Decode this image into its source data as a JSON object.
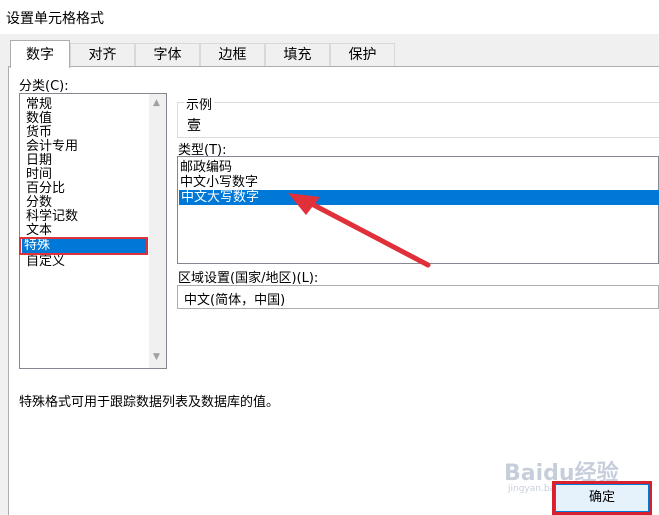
{
  "window": {
    "title": "设置单元格格式"
  },
  "tabs": [
    {
      "label": "数字",
      "active": true
    },
    {
      "label": "对齐",
      "active": false
    },
    {
      "label": "字体",
      "active": false
    },
    {
      "label": "边框",
      "active": false
    },
    {
      "label": "填充",
      "active": false
    },
    {
      "label": "保护",
      "active": false
    }
  ],
  "category": {
    "label": "分类(C):",
    "items": [
      "常规",
      "数值",
      "货币",
      "会计专用",
      "日期",
      "时间",
      "百分比",
      "分数",
      "科学记数",
      "文本",
      "特殊",
      "自定义"
    ],
    "selected": "特殊"
  },
  "sample": {
    "label": "示例",
    "value": "壹"
  },
  "type": {
    "label": "类型(T):",
    "items": [
      "邮政编码",
      "中文小写数字",
      "中文大写数字"
    ],
    "selected": "中文大写数字"
  },
  "locale": {
    "label": "区域设置(国家/地区)(L):",
    "value": "中文(简体，中国)"
  },
  "description": "特殊格式可用于跟踪数据列表及数据库的值。",
  "buttons": {
    "ok": "确定"
  },
  "watermark": {
    "text": "Baidu经验",
    "sub": "jingyan.baidu.com"
  },
  "colors": {
    "selection": "#0078d7",
    "annotation": "#e0303a"
  }
}
